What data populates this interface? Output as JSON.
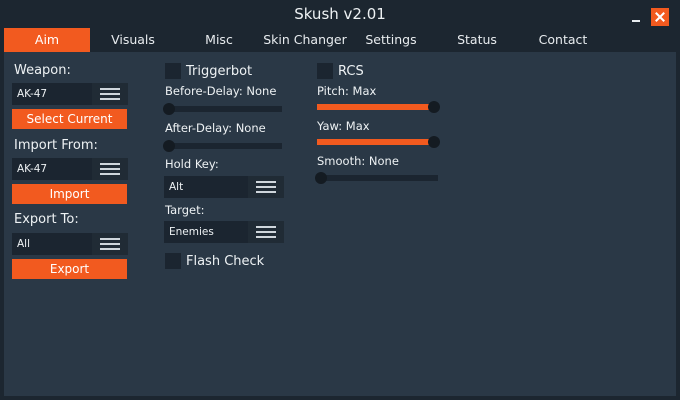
{
  "app": {
    "title": "Skush v2.01"
  },
  "tabs": [
    {
      "label": "Aim"
    },
    {
      "label": "Visuals"
    },
    {
      "label": "Misc"
    },
    {
      "label": "Skin Changer"
    },
    {
      "label": "Settings"
    },
    {
      "label": "Status"
    },
    {
      "label": "Contact"
    }
  ],
  "left": {
    "weapon_label": "Weapon:",
    "weapon_value": "AK-47",
    "select_current": "Select Current",
    "import_label": "Import From:",
    "import_value": "AK-47",
    "import_button": "Import",
    "export_label": "Export To:",
    "export_value": "All",
    "export_button": "Export"
  },
  "middle": {
    "triggerbot_label": "Triggerbot",
    "triggerbot_checked": false,
    "before_delay": "Before-Delay: None",
    "before_delay_level": 0,
    "after_delay": "After-Delay: None",
    "after_delay_level": 0,
    "hold_key_label": "Hold Key:",
    "hold_key_value": "Alt",
    "target_label": "Target:",
    "target_value": "Enemies",
    "flash_check_label": "Flash Check",
    "flash_check_checked": false
  },
  "right": {
    "rcs_label": "RCS",
    "rcs_checked": false,
    "pitch": "Pitch: Max",
    "pitch_level": 1.0,
    "yaw": "Yaw: Max",
    "yaw_level": 1.0,
    "smooth": "Smooth: None",
    "smooth_level": 0
  },
  "colors": {
    "accent": "#f25a1f",
    "background": "#1c2630",
    "panel": "#2a3846",
    "control": "#1b2530"
  },
  "icons": [
    "minimize-icon",
    "close-icon",
    "hamburger-icon"
  ]
}
